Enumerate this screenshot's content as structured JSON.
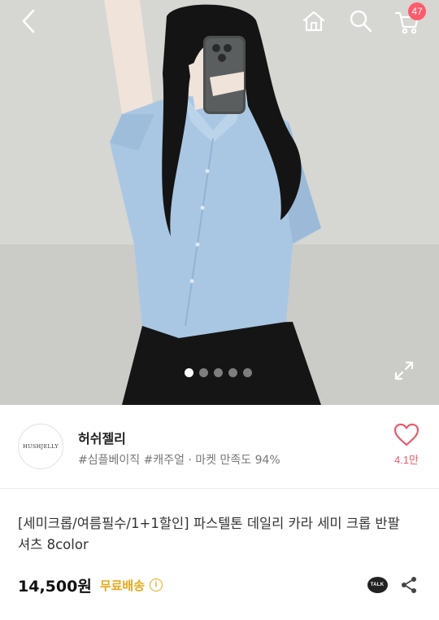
{
  "header": {
    "cart_badge": "47"
  },
  "icons": {
    "back": "chevron-left-icon",
    "home": "home-icon",
    "search": "search-icon",
    "cart": "cart-icon",
    "expand": "expand-icon",
    "like": "heart-icon",
    "info": "info-icon",
    "talk": "kakao-talk-icon",
    "share": "share-icon"
  },
  "gallery": {
    "total_images": 5,
    "active_index": 0
  },
  "seller": {
    "logo_text": "HUSHJELLY",
    "name": "허쉬젤리",
    "tags": "#심플베이직 #캐주얼 · 마켓 만족도 94%",
    "like_count": "4.1만"
  },
  "product": {
    "title": "[세미크롭/여름필수/1+1할인] 파스텔톤 데일리 카라 세미 크롭 반팔 셔츠 8color",
    "price": "14,500원",
    "shipping": "무료배송",
    "info_glyph": "i",
    "talk_label": "TALK"
  },
  "colors": {
    "accent_pink": "#e85a6a",
    "badge": "#ff5a6b",
    "shipping": "#e8a81a",
    "shirt": "#a9c7e3"
  }
}
